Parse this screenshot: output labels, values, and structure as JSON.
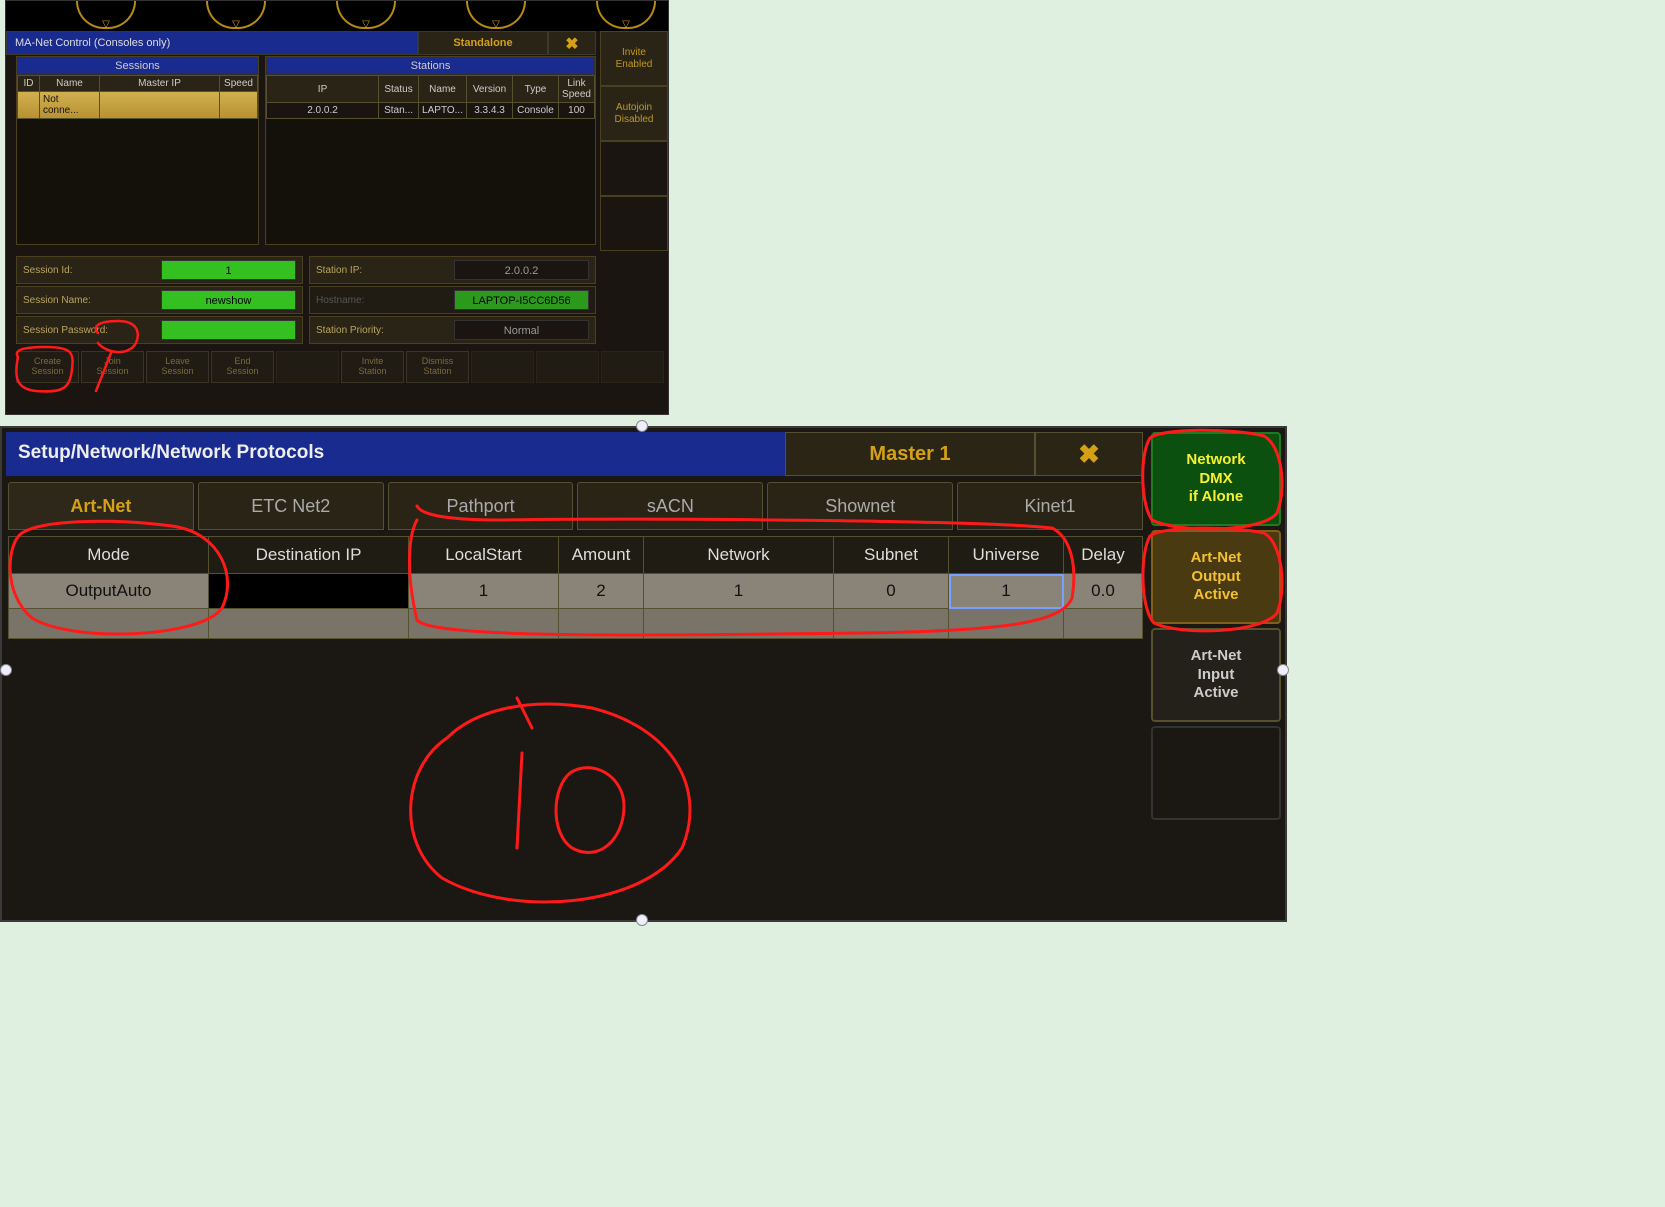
{
  "top": {
    "title": "MA-Net Control (Consoles only)",
    "standalone": "Standalone",
    "close": "✖",
    "side": {
      "invite": "Invite\nEnabled",
      "autojoin": "Autojoin\nDisabled"
    },
    "sessions": {
      "caption": "Sessions",
      "cols": {
        "id": "ID",
        "name": "Name",
        "master_ip": "Master IP",
        "speed": "Speed"
      },
      "row0": {
        "name": "Not conne..."
      }
    },
    "stations": {
      "caption": "Stations",
      "cols": {
        "ip": "IP",
        "status": "Status",
        "name": "Name",
        "version": "Version",
        "type": "Type",
        "link_speed": "Link Speed"
      },
      "row0": {
        "ip": "2.0.0.2",
        "status": "Stan...",
        "name": "LAPTO...",
        "version": "3.3.4.3",
        "type": "Console",
        "link_speed": "100"
      }
    },
    "form": {
      "session_id_lbl": "Session Id:",
      "session_id_val": "1",
      "session_name_lbl": "Session Name:",
      "session_name_val": "newshow",
      "session_pwd_lbl": "Session Password:",
      "session_pwd_val": "",
      "station_ip_lbl": "Station IP:",
      "station_ip_val": "2.0.0.2",
      "hostname_lbl": "Hostname:",
      "hostname_val": "LAPTOP-I5CC6D56",
      "priority_lbl": "Station Priority:",
      "priority_val": "Normal"
    },
    "buttons": {
      "create": "Create\nSession",
      "join": "Join\nSession",
      "leave": "Leave\nSession",
      "end": "End\nSession",
      "invite": "Invite\nStation",
      "dismiss": "Dismiss\nStation"
    }
  },
  "bottom": {
    "title": "Setup/Network/Network Protocols",
    "master": "Master 1",
    "close": "✖",
    "right": {
      "dmx_alone": "Network\nDMX\nif Alone",
      "artnet_out": "Art-Net\nOutput\nActive",
      "artnet_in": "Art-Net\nInput\nActive"
    },
    "tabs": {
      "artnet": "Art-Net",
      "etc": "ETC Net2",
      "pathport": "Pathport",
      "sacn": "sACN",
      "shownet": "Shownet",
      "kinet": "Kinet1"
    },
    "grid": {
      "cols": {
        "mode": "Mode",
        "dest": "Destination IP",
        "local": "LocalStart",
        "amount": "Amount",
        "network": "Network",
        "subnet": "Subnet",
        "universe": "Universe",
        "delay": "Delay"
      },
      "row0": {
        "mode": "OutputAuto",
        "dest": "",
        "local": "1",
        "amount": "2",
        "network": "1",
        "subnet": "0",
        "universe": "1",
        "delay": "0.0"
      }
    }
  }
}
